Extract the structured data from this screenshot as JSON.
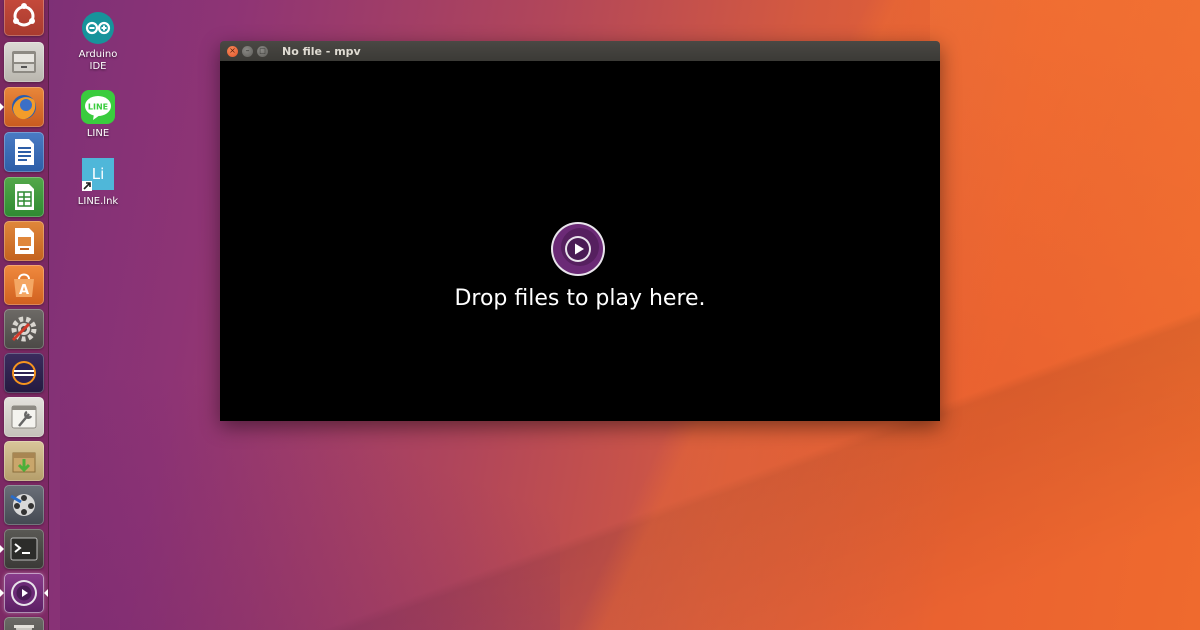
{
  "desktop": {
    "icons": [
      {
        "label_line1": "Arduino",
        "label_line2": "IDE",
        "icon": "arduino-icon"
      },
      {
        "label_line1": "LINE",
        "label_line2": "",
        "icon": "line-icon",
        "badge_text": "LINE"
      },
      {
        "label_line1": "LINE.lnk",
        "label_line2": "",
        "icon": "libreoffice-link-icon",
        "badge_text": "Li"
      }
    ]
  },
  "launcher": {
    "items": [
      {
        "name": "ubuntu-dash-icon"
      },
      {
        "name": "files-icon"
      },
      {
        "name": "firefox-icon"
      },
      {
        "name": "libreoffice-writer-icon"
      },
      {
        "name": "libreoffice-calc-icon"
      },
      {
        "name": "libreoffice-impress-icon"
      },
      {
        "name": "software-center-icon"
      },
      {
        "name": "system-settings-icon"
      },
      {
        "name": "eclipse-icon"
      },
      {
        "name": "system-tools-icon"
      },
      {
        "name": "archive-install-icon"
      },
      {
        "name": "video-tools-icon"
      },
      {
        "name": "terminal-icon"
      },
      {
        "name": "mpv-icon"
      },
      {
        "name": "trash-icon"
      }
    ]
  },
  "window": {
    "title": "No file - mpv",
    "close_glyph": "×",
    "min_glyph": "–",
    "max_glyph": "□",
    "drop_message": "Drop files to play here."
  },
  "colors": {
    "mpv_purple": "#5a1e68",
    "window_titlebar": "#3b3a36",
    "close_button": "#e0542a"
  }
}
